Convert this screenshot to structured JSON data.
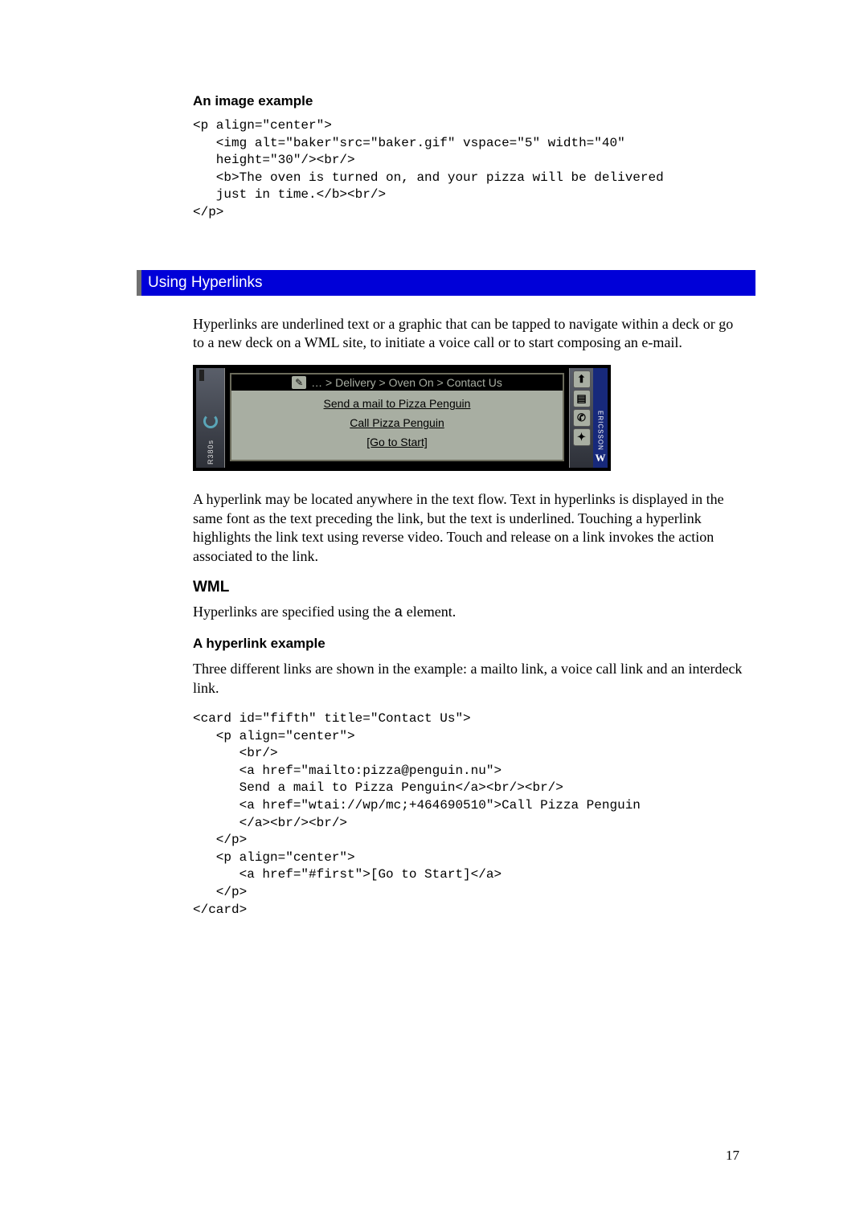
{
  "section1": {
    "heading": "An image example",
    "code": [
      "<p align=\"center\">",
      "   <img alt=\"baker\"src=\"baker.gif\" vspace=\"5\" width=\"40\"",
      "   height=\"30\"/><br/>",
      "   <b>The oven is turned on, and your pizza will be delivered",
      "   just in time.</b><br/>",
      "</p>"
    ]
  },
  "section_bar": "Using Hyperlinks",
  "para1": "Hyperlinks are underlined text or a graphic that can be tapped to navigate within a deck or go to a new deck on a WML site, to initiate a voice call or to start composing an e-mail.",
  "device": {
    "model": "R380s",
    "brand": "ERICSSON",
    "titlebar": "… > Delivery > Oven On > Contact Us",
    "links": [
      "Send a mail to Pizza Penguin",
      "Call Pizza Penguin",
      "[Go to Start]"
    ],
    "icons": [
      "up-arrow",
      "doc",
      "phone",
      "nav"
    ]
  },
  "para2": "A hyperlink may be located anywhere in the text flow.  Text in hyperlinks is displayed in the same font as the text preceding the link, but the text is underlined.  Touching a hyperlink highlights the link text using reverse video.  Touch and release on a link invokes the action associated to the link.",
  "wml": {
    "heading": "WML",
    "text_pre": "Hyperlinks are specified using the ",
    "text_mono": "a",
    "text_post": " element."
  },
  "section2": {
    "heading": "A hyperlink example",
    "intro": "Three different links are shown in the example: a mailto link, a voice call link and an interdeck link.",
    "code": [
      "<card id=\"fifth\" title=\"Contact Us\">",
      "   <p align=\"center\">",
      "      <br/>",
      "      <a href=\"mailto:pizza@penguin.nu\">",
      "      Send a mail to Pizza Penguin</a><br/><br/>",
      "      <a href=\"wtai://wp/mc;+464690510\">Call Pizza Penguin",
      "      </a><br/><br/>",
      "   </p>",
      "   <p align=\"center\">",
      "      <a href=\"#first\">[Go to Start]</a>",
      "   </p>",
      "</card>"
    ]
  },
  "page_number": "17"
}
